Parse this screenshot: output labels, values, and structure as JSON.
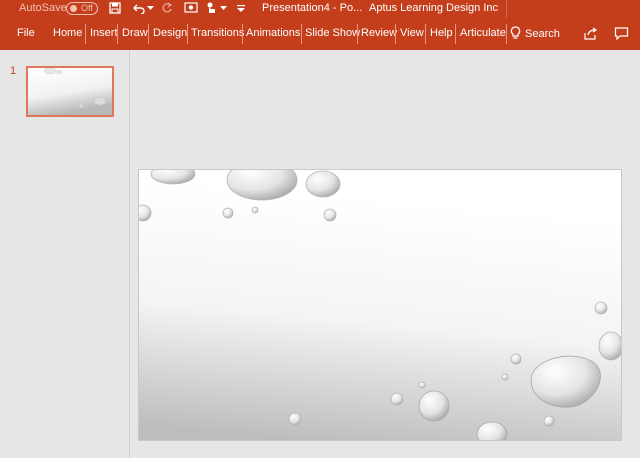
{
  "titlebar": {
    "autosave_label": "AutoSave",
    "autosave_state": "Off",
    "document_title": "Presentation4  -  Po...",
    "organization": "Aptus Learning Design Inc",
    "icons": [
      "save-icon",
      "undo-icon",
      "dropdown-icon",
      "redo-icon",
      "record-icon",
      "touch-mode-icon",
      "dropdown-icon",
      "customize-qat-icon"
    ]
  },
  "ribbon": {
    "tabs": [
      {
        "label": "File"
      },
      {
        "label": "Home"
      },
      {
        "label": "Insert"
      },
      {
        "label": "Draw"
      },
      {
        "label": "Design"
      },
      {
        "label": "Transitions"
      },
      {
        "label": "Animations"
      },
      {
        "label": "Slide Show"
      },
      {
        "label": "Review"
      },
      {
        "label": "View"
      },
      {
        "label": "Help"
      },
      {
        "label": "Articulate"
      }
    ],
    "search_label": "Search",
    "right_icons": [
      "share-icon",
      "comments-icon"
    ]
  },
  "thumbnails": [
    {
      "number": "1"
    }
  ],
  "colors": {
    "accent": "#c43e1c",
    "selection": "#e0775a",
    "canvas": "#e6e6e6"
  }
}
